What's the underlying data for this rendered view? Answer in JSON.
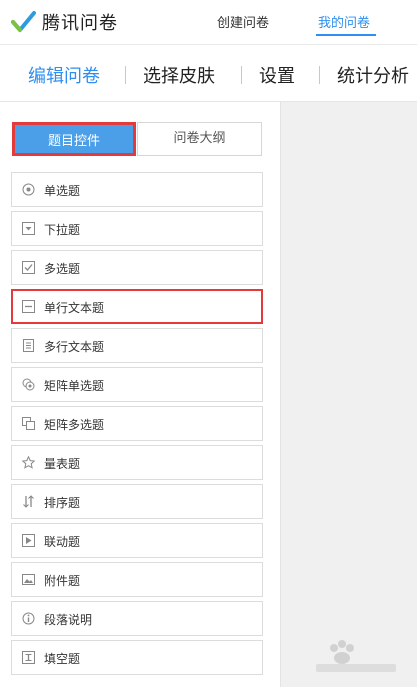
{
  "app": {
    "logo_text": "腾讯问卷",
    "nav": {
      "create": "创建问卷",
      "mine": "我的问卷"
    }
  },
  "tabs": [
    {
      "label": "编辑问卷",
      "active": true
    },
    {
      "label": "选择皮肤",
      "active": false
    },
    {
      "label": "设置",
      "active": false
    },
    {
      "label": "统计分析",
      "active": false
    }
  ],
  "panel": {
    "segments": {
      "controls": "题目控件",
      "outline": "问卷大纲",
      "selected": "controls"
    },
    "items": [
      {
        "label": "单选题",
        "icon": "radio-icon"
      },
      {
        "label": "下拉题",
        "icon": "dropdown-icon"
      },
      {
        "label": "多选题",
        "icon": "checkbox-icon"
      },
      {
        "label": "单行文本题",
        "icon": "single-line-text-icon",
        "highlighted": true
      },
      {
        "label": "多行文本题",
        "icon": "multi-line-text-icon"
      },
      {
        "label": "矩阵单选题",
        "icon": "matrix-radio-icon"
      },
      {
        "label": "矩阵多选题",
        "icon": "matrix-checkbox-icon"
      },
      {
        "label": "量表题",
        "icon": "star-icon"
      },
      {
        "label": "排序题",
        "icon": "sort-icon"
      },
      {
        "label": "联动题",
        "icon": "linkage-icon"
      },
      {
        "label": "附件题",
        "icon": "attachment-icon"
      },
      {
        "label": "段落说明",
        "icon": "info-icon"
      },
      {
        "label": "填空题",
        "icon": "fill-blank-icon"
      }
    ]
  },
  "colors": {
    "accent": "#2e8ff0",
    "segment_bg": "#4a9fe8",
    "highlight_border": "#e33b3b"
  }
}
